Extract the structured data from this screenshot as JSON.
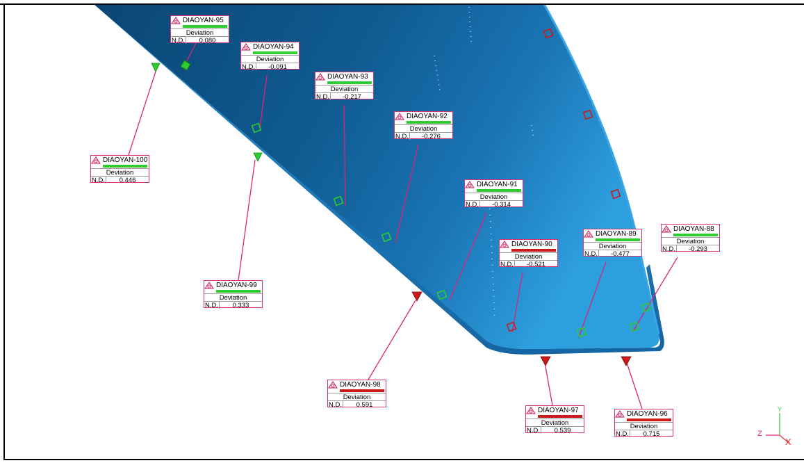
{
  "colors": {
    "surface_dark": "#0d4f7f",
    "surface_light": "#2a9ad8",
    "surface_edge": "#1f7fc0",
    "leader": "#e0207a",
    "in_tolerance": "#2ecc2e",
    "out_of_tolerance": "#cc1a1a",
    "label_border": "#d6337a"
  },
  "labels": [
    {
      "id": "DIAOYAN-95",
      "deviation_label": "Deviation",
      "nd_label": "N.D.",
      "value": "0.080",
      "status": "green"
    },
    {
      "id": "DIAOYAN-94",
      "deviation_label": "Deviation",
      "nd_label": "N.D.",
      "value": "-0.091",
      "status": "green"
    },
    {
      "id": "DIAOYAN-93",
      "deviation_label": "Deviation",
      "nd_label": "N.D.",
      "value": "-0.217",
      "status": "green"
    },
    {
      "id": "DIAOYAN-92",
      "deviation_label": "Deviation",
      "nd_label": "N.D.",
      "value": "-0.276",
      "status": "green"
    },
    {
      "id": "DIAOYAN-100",
      "deviation_label": "Deviation",
      "nd_label": "N.D.",
      "value": "0.446",
      "status": "green"
    },
    {
      "id": "DIAOYAN-91",
      "deviation_label": "Deviation",
      "nd_label": "N.D.",
      "value": "-0.314",
      "status": "green"
    },
    {
      "id": "DIAOYAN-90",
      "deviation_label": "Deviation",
      "nd_label": "N.D.",
      "value": "-0.521",
      "status": "red"
    },
    {
      "id": "DIAOYAN-89",
      "deviation_label": "Deviation",
      "nd_label": "N.D.",
      "value": "-0.477",
      "status": "green"
    },
    {
      "id": "DIAOYAN-88",
      "deviation_label": "Deviation",
      "nd_label": "N.D.",
      "value": "-0.293",
      "status": "green"
    },
    {
      "id": "DIAOYAN-99",
      "deviation_label": "Deviation",
      "nd_label": "N.D.",
      "value": "0.333",
      "status": "green"
    },
    {
      "id": "DIAOYAN-98",
      "deviation_label": "Deviation",
      "nd_label": "N.D.",
      "value": "0.591",
      "status": "red"
    },
    {
      "id": "DIAOYAN-97",
      "deviation_label": "Deviation",
      "nd_label": "N.D.",
      "value": "0.539",
      "status": "red"
    },
    {
      "id": "DIAOYAN-96",
      "deviation_label": "Deviation",
      "nd_label": "N.D.",
      "value": "0.715",
      "status": "red"
    }
  ],
  "axes": {
    "x": "X",
    "y": "Y",
    "z": "Z"
  },
  "icons": {
    "label_icon": "measurement-point-icon",
    "axis_triad": "axis-triad-icon"
  }
}
